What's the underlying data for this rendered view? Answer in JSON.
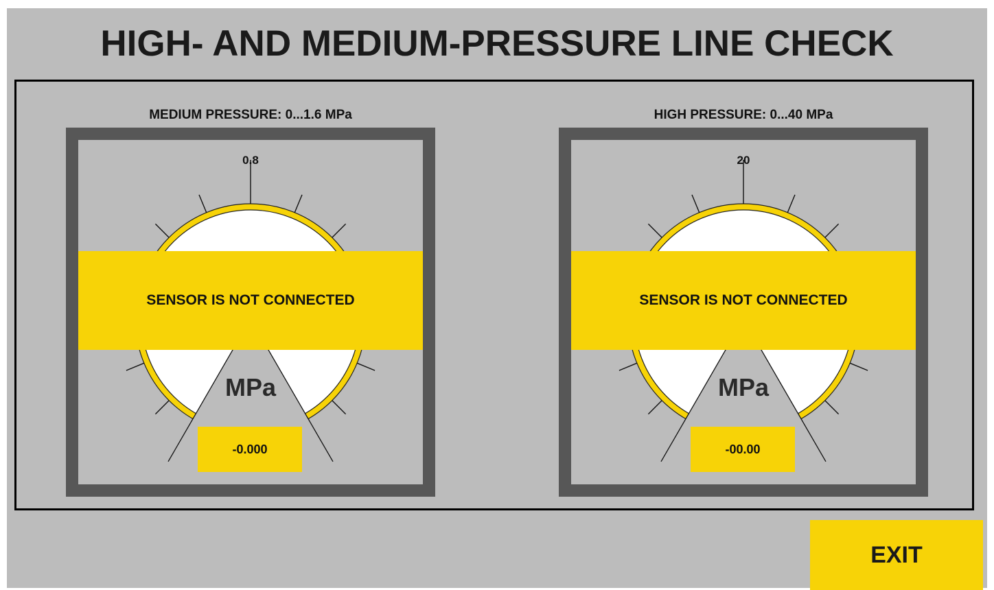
{
  "title": "HIGH- AND MEDIUM-PRESSURE LINE CHECK",
  "gauges": [
    {
      "caption": "MEDIUM PRESSURE: 0...1.6 MPa",
      "scale_mid_label": "0.8",
      "status": "SENSOR IS NOT CONNECTED",
      "unit": "MPa",
      "reading": "-0.000"
    },
    {
      "caption": "HIGH PRESSURE: 0...40 MPa",
      "scale_mid_label": "20",
      "status": "SENSOR IS NOT CONNECTED",
      "unit": "MPa",
      "reading": "-00.00"
    }
  ],
  "exit_label": "EXIT",
  "colors": {
    "background": "#bcbcbc",
    "frame": "#575757",
    "accent_yellow": "#f7d307",
    "dial_face": "#ffffff",
    "text": "#111111"
  }
}
